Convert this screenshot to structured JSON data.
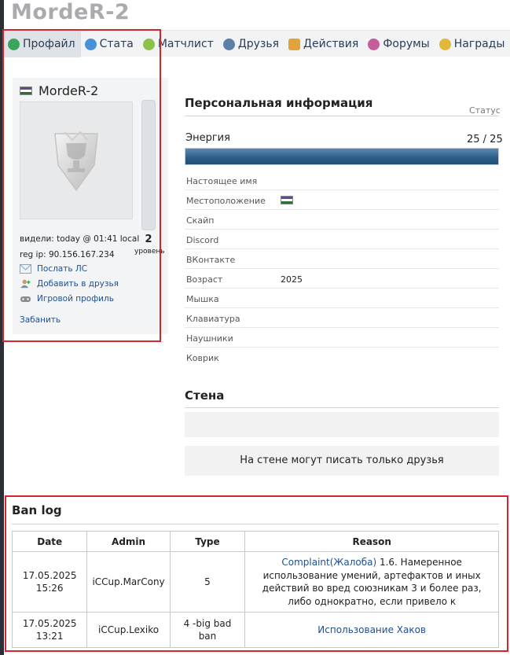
{
  "page": {
    "title": "MordeR-2"
  },
  "tabs": [
    {
      "label": "Профайл",
      "icon": "profile-icon",
      "active": true
    },
    {
      "label": "Стата",
      "icon": "stats-icon"
    },
    {
      "label": "Матчлист",
      "icon": "matchlist-icon"
    },
    {
      "label": "Друзья",
      "icon": "friends-icon"
    },
    {
      "label": "Действия",
      "icon": "actions-icon"
    },
    {
      "label": "Форумы",
      "icon": "forums-icon"
    },
    {
      "label": "Награды",
      "icon": "awards-icon"
    }
  ],
  "profile": {
    "name": "MordeR-2",
    "level": "2",
    "level_label": "уровень",
    "last_seen": "видели: today @ 01:41 local",
    "reg_ip": "reg ip: 90.156.167.234",
    "send_pm": "Послать ЛС",
    "add_friend": "Добавить в друзья",
    "game_profile": "Игровой профиль",
    "ban": "Забанить"
  },
  "personal": {
    "title": "Персональная информация",
    "status_label": "Статус",
    "energy_label": "Энергия",
    "energy_value": "25 / 25",
    "energy_fraction": 1.0,
    "rows": [
      {
        "key": "Настоящее имя",
        "value": ""
      },
      {
        "key": "Местоположение",
        "value": ""
      },
      {
        "key": "Скайп",
        "value": ""
      },
      {
        "key": "Discord",
        "value": ""
      },
      {
        "key": "ВКонтакте",
        "value": ""
      },
      {
        "key": "Возраст",
        "value": "2025"
      },
      {
        "key": "Мышка",
        "value": ""
      },
      {
        "key": "Клавиатура",
        "value": ""
      },
      {
        "key": "Наушники",
        "value": ""
      },
      {
        "key": "Коврик",
        "value": ""
      }
    ]
  },
  "wall": {
    "title": "Стена",
    "notice": "На стене могут писать только друзья"
  },
  "banlog": {
    "title": "Ban log",
    "headers": [
      "Date",
      "Admin",
      "Type",
      "Reason"
    ],
    "rows": [
      {
        "date": "17.05.2025 15:26",
        "admin": "iCCup.MarCony",
        "type": "5",
        "reason_link": "Complaint(Жалоба)",
        "reason_text": " 1.6. Намеренное использование умений, артефактов и иных действий во вред союзникам 3 и более раз, либо однократно, если привело к"
      },
      {
        "date": "17.05.2025 13:21",
        "admin": "iCCup.Lexiko",
        "type": "4 -big bad ban",
        "reason_link": "Использование Хаков",
        "reason_text": ""
      }
    ]
  }
}
